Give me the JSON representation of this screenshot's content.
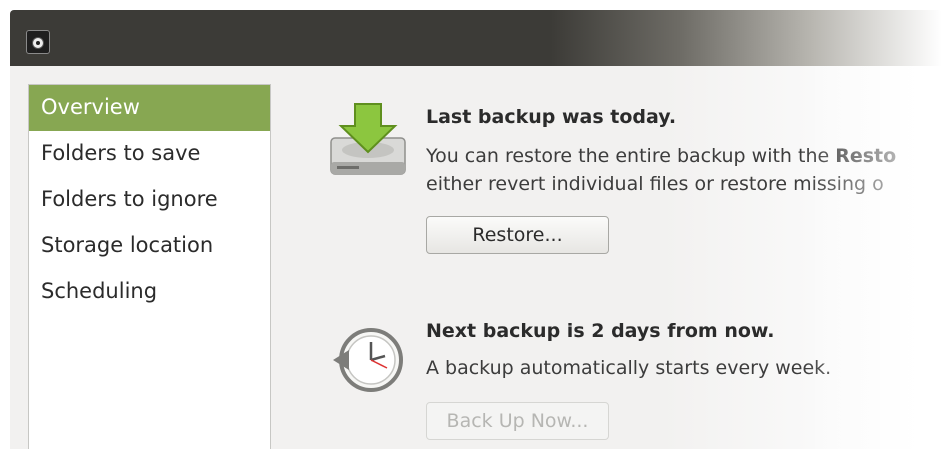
{
  "window": {
    "app_icon": "backup-app-icon"
  },
  "sidebar": {
    "items": [
      {
        "label": "Overview",
        "active": true
      },
      {
        "label": "Folders to save",
        "active": false
      },
      {
        "label": "Folders to ignore",
        "active": false
      },
      {
        "label": "Storage location",
        "active": false
      },
      {
        "label": "Scheduling",
        "active": false
      }
    ]
  },
  "last_backup": {
    "icon": "drive-download-icon",
    "heading": "Last backup was today.",
    "desc_line1_prefix": "You can restore the entire backup with the ",
    "desc_line1_bold": "Resto",
    "desc_line2": "either revert individual files or restore missing o",
    "button_label": "Restore..."
  },
  "next_backup": {
    "icon": "clock-backup-icon",
    "heading": "Next backup is 2 days from now.",
    "desc": "A backup automatically starts every week.",
    "button_label": "Back Up Now..."
  },
  "colors": {
    "titlebar": "#3c3b37",
    "sidebar_active": "#87a752",
    "panel_bg": "#f2f1f0",
    "arrow_green": "#8cc63f"
  }
}
